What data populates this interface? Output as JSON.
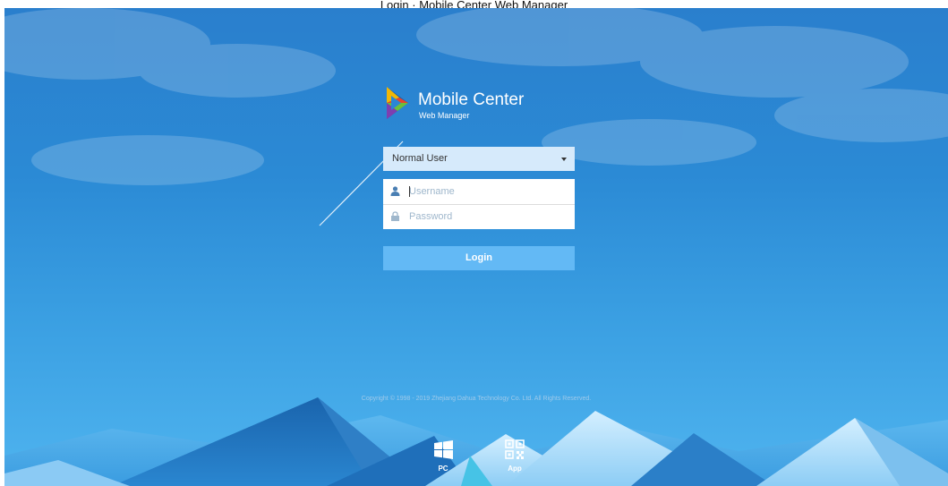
{
  "window": {
    "title": "Login · Mobile Center Web Manager"
  },
  "brand": {
    "title": "Mobile Center",
    "subtitle": "Web Manager"
  },
  "login_form": {
    "role_select": {
      "value": "Normal User",
      "options": [
        "Normal User"
      ]
    },
    "username": {
      "placeholder": "Username",
      "value": ""
    },
    "password": {
      "placeholder": "Password",
      "value": ""
    },
    "login_label": "Login"
  },
  "footer": {
    "copyright": "Copyright © 1998 - 2019 Zhejiang Dahua Technology Co. Ltd. All Rights Reserved.",
    "platforms": [
      {
        "label": "PC",
        "icon": "windows-icon"
      },
      {
        "label": "App",
        "icon": "qr-code-icon"
      }
    ]
  },
  "colors": {
    "sky_top": "#2a7fcd",
    "sky_bottom": "#4fb4ef",
    "select_bg": "#d6eafb",
    "login_button": "#63b9f5",
    "mountain_dark": "#1f6fba",
    "mountain_light": "#b8e2fb"
  }
}
